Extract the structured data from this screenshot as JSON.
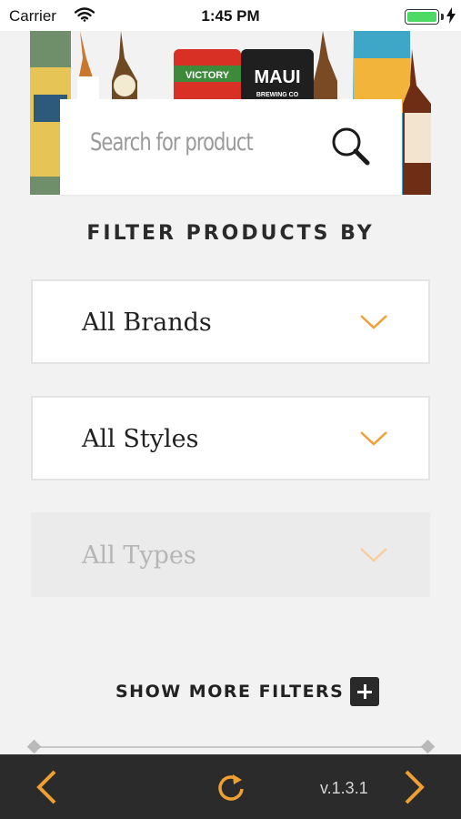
{
  "status_bar": {
    "carrier": "Carrier",
    "time": "1:45 PM",
    "battery_level": 1.0,
    "battery_color": "#4cd964"
  },
  "hero": {
    "image": "beer-cans-and-bottles-banner",
    "can_labels": [
      "VICTORY",
      "MAUI",
      "BREWING CO"
    ]
  },
  "search": {
    "placeholder": "Search for product",
    "icon": "search-icon"
  },
  "filter_section": {
    "title": "FILTER PRODUCTS BY",
    "filters": [
      {
        "label": "All Brands",
        "enabled": true,
        "icon": "chevron-down-icon"
      },
      {
        "label": "All Styles",
        "enabled": true,
        "icon": "chevron-down-icon"
      },
      {
        "label": "All Types",
        "enabled": false,
        "icon": "chevron-down-icon"
      }
    ],
    "show_more_label": "SHOW MORE FILTERS",
    "show_more_icon": "plus-icon"
  },
  "bottom_bar": {
    "back_icon": "chevron-left-icon",
    "refresh_icon": "refresh-icon",
    "version": "v.1.3.1",
    "forward_icon": "chevron-right-icon"
  },
  "colors": {
    "accent": "#f0a033",
    "bottom_bar": "#2b2b2b",
    "background": "#f2f2f2"
  }
}
